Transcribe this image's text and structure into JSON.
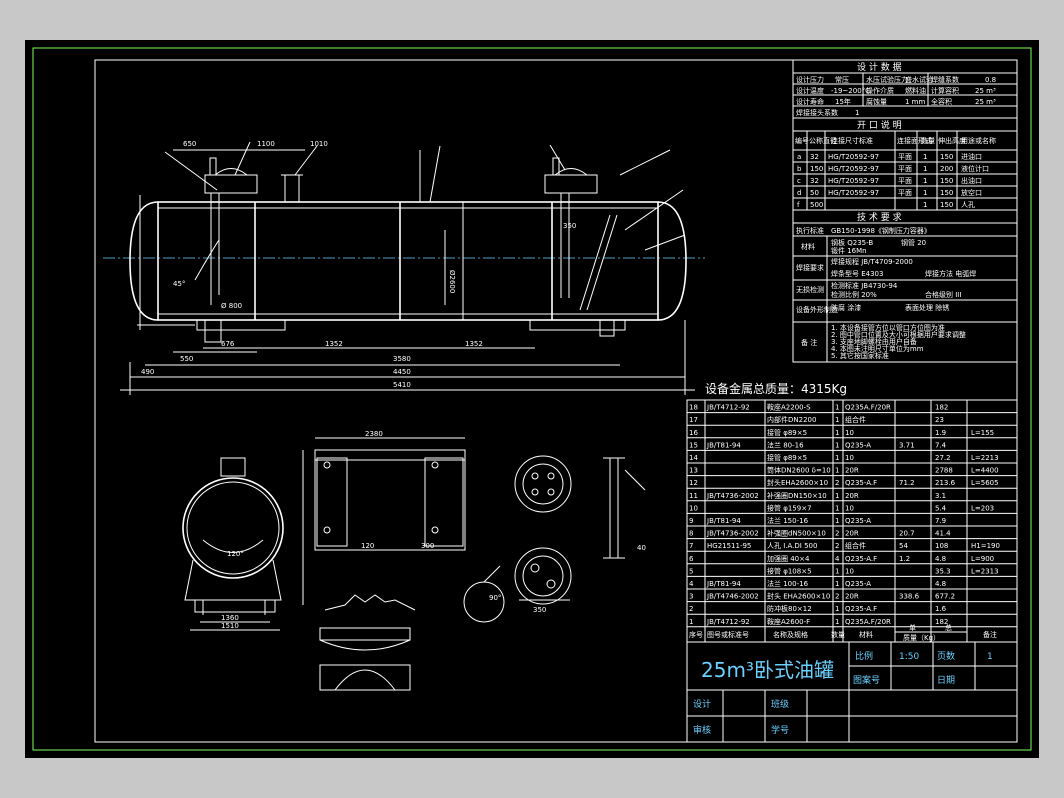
{
  "design_data": {
    "title": "设 计 数 据",
    "rows": [
      [
        "设计压力",
        "常压",
        "水压试验压力",
        "盛水试验",
        "焊缝系数",
        "0.8"
      ],
      [
        "设计温度",
        "-19~200°C",
        "操作介质",
        "燃料油",
        "计算容积",
        "25 m³"
      ],
      [
        "设计寿命",
        "15年",
        "腐蚀量",
        "1 mm",
        "全容积",
        "25 m³"
      ],
      [
        "焊接接头系数",
        "1",
        "",
        "",
        "",
        ""
      ]
    ]
  },
  "openings": {
    "title": "开 口 说 明",
    "header": [
      "编号",
      "公称直径",
      "连接尺寸标准",
      "连接面形式",
      "数量",
      "伸出高度",
      "用途或名称"
    ],
    "rows": [
      [
        "a",
        "32",
        "HG/T20592-97",
        "平面",
        "1",
        "150",
        "进油口"
      ],
      [
        "b",
        "150",
        "HG/T20592-97",
        "平面",
        "1",
        "200",
        "液位计口"
      ],
      [
        "c",
        "32",
        "HG/T20592-97",
        "平面",
        "1",
        "150",
        "出油口"
      ],
      [
        "d",
        "50",
        "HG/T20592-97",
        "平面",
        "1",
        "150",
        "放空口"
      ],
      [
        "f",
        "500",
        "",
        "",
        "1",
        "150",
        "人孔"
      ]
    ]
  },
  "tech": {
    "title": "技 术 要 求",
    "rows": [
      [
        "执行标准",
        "GB150-1998《钢制压力容器》"
      ],
      [
        "材料",
        "钢板 Q235-B",
        "钢管 20",
        "锻件 16Mn"
      ],
      [
        "焊接要求",
        "焊接规程 JB/T4709-2000",
        "焊条型号 E4303",
        "焊接方法 电弧焊"
      ],
      [
        "无损检测",
        "检测标准 JB4730-94",
        "检测比例 20%",
        "合格级别 III"
      ],
      [
        "设备外形制造",
        "防腐 涂漆",
        "表面处理 除锈"
      ]
    ],
    "notes_label": "备 注",
    "notes": [
      "1. 本设备接管方位以管口方位图为准",
      "2. 图中管口位置及大小可根据用户要求调整",
      "3. 支座地脚螺栓由用户自备",
      "4. 本图未注明尺寸单位为mm",
      "5. 其它按国家标准"
    ]
  },
  "mass_label": "设备金属总质量：4315Kg",
  "bom": {
    "header": [
      "序号",
      "图号或标准号",
      "名称及规格",
      "数量",
      "材料",
      "单",
      "总",
      "备注"
    ],
    "unit_label": "质量（Kg）",
    "rows": [
      [
        "18",
        "JB/T4712-92",
        "鞍座A2200-S",
        "1",
        "Q235A.F/20R",
        "",
        "182",
        ""
      ],
      [
        "17",
        "",
        "内部件DN2200",
        "1",
        "组合件",
        "",
        "23",
        ""
      ],
      [
        "16",
        "",
        "接管 φ89×5",
        "1",
        "10",
        "",
        "1.9",
        "L=155"
      ],
      [
        "15",
        "JB/T81-94",
        "法兰 80-16",
        "1",
        "Q235-A",
        "3.71",
        "7.4",
        ""
      ],
      [
        "14",
        "",
        "接管 φ89×5",
        "1",
        "10",
        "",
        "27.2",
        "L=2213"
      ],
      [
        "13",
        "",
        "筒体DN2600 δ=10",
        "1",
        "20R",
        "",
        "2788",
        "L=4400"
      ],
      [
        "12",
        "",
        "封头EHA2600×10",
        "2",
        "Q235-A.F",
        "71.2",
        "213.6",
        "L=5605"
      ],
      [
        "11",
        "JB/T4736-2002",
        "补强圈DN150×10",
        "1",
        "20R",
        "",
        "3.1",
        ""
      ],
      [
        "10",
        "",
        "接管 φ159×7",
        "1",
        "10",
        "",
        "5.4",
        "L=203"
      ],
      [
        "9",
        "JB/T81-94",
        "法兰 150-16",
        "1",
        "Q235-A",
        "",
        "7.9",
        ""
      ],
      [
        "8",
        "JB/T4736-2002",
        "补强圈dN500×10",
        "2",
        "20R",
        "20.7",
        "41.4",
        ""
      ],
      [
        "7",
        "HG21511-95",
        "人孔 I.A.DI 500",
        "2",
        "组合件",
        "54",
        "108",
        "H1=190"
      ],
      [
        "6",
        "",
        "加强圈 40×4",
        "4",
        "Q235-A.F",
        "1.2",
        "4.8",
        "L=900"
      ],
      [
        "5",
        "",
        "接管 φ108×5",
        "1",
        "10",
        "",
        "35.3",
        "L=2313"
      ],
      [
        "4",
        "JB/T81-94",
        "法兰 100-16",
        "1",
        "Q235-A",
        "",
        "4.8",
        ""
      ],
      [
        "3",
        "JB/T4746-2002",
        "封头 EHA2600×10",
        "2",
        "20R",
        "338.6",
        "677.2",
        ""
      ],
      [
        "2",
        "",
        "防冲板80×12",
        "1",
        "Q235-A.F",
        "",
        "1.6",
        ""
      ],
      [
        "1",
        "JB/T4712-92",
        "鞍座A2600-F",
        "1",
        "Q235A.F/20R",
        "",
        "182",
        ""
      ]
    ]
  },
  "title_block": {
    "title": "25m³卧式油罐",
    "scale_label": "比例",
    "scale_value": "1:50",
    "pages_label": "页数",
    "pages_value": "1",
    "drawing_no_label": "图案号",
    "date_label": "日期",
    "designer_label": "设计",
    "class_label": "班级",
    "reviewer_label": "审核",
    "student_no_label": "学号"
  },
  "dims": {
    "d650": "650",
    "d1100": "1100",
    "d1010": "1010",
    "d550": "550",
    "d490": "490",
    "d1352a": "1352",
    "d1352b": "1352",
    "d3580": "3580",
    "d4450": "4450",
    "d5410": "5410",
    "d2600": "Ø2600",
    "d800": "Ø 800",
    "d676": "676",
    "d350": "350",
    "d2380": "2380",
    "d1510": "1510",
    "d1360": "1360",
    "d120": "120",
    "d300": "300",
    "d350b": "350",
    "d40": "40",
    "d90": "90°",
    "d120deg": "120°",
    "d45": "45°"
  },
  "colors": {
    "background": "#000000",
    "line": "#ffffff",
    "border": "#7cff5a",
    "title": "#6ad1ff"
  }
}
